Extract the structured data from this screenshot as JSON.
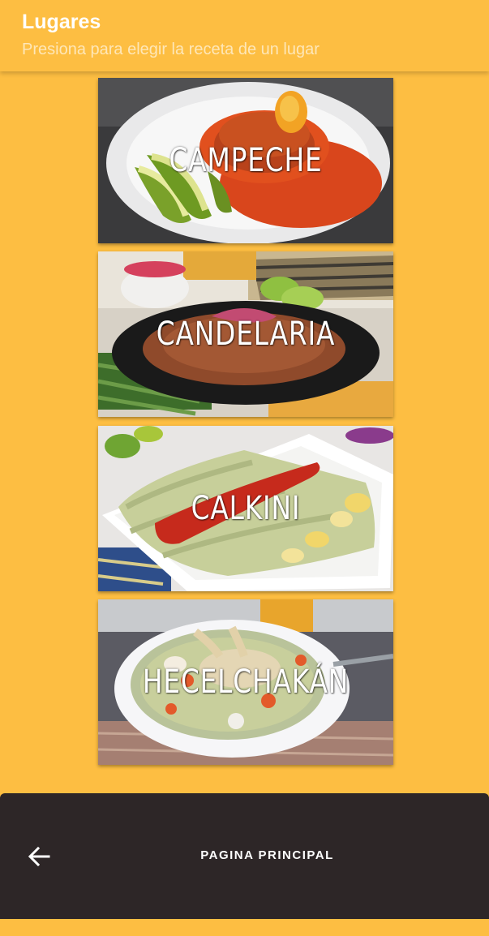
{
  "header": {
    "title": "Lugares",
    "subtitle": "Presiona para elegir la receta de un lugar"
  },
  "places": [
    {
      "label": "CAMPECHE",
      "image": "pan-de-cazon-dish"
    },
    {
      "label": "CANDELARIA",
      "image": "cochinita-pibil-dish"
    },
    {
      "label": "CALKINI",
      "image": "enchiladas-verdes-dish"
    },
    {
      "label": "HECELCHAKÁN",
      "image": "chicken-soup-dish"
    }
  ],
  "bottom_nav": {
    "back_icon": "arrow-left-icon",
    "label": "PAGINA PRINCIPAL"
  },
  "colors": {
    "background": "#FDBE42",
    "bottom_bar": "#2D2627",
    "text_light": "#FFFFFF"
  }
}
